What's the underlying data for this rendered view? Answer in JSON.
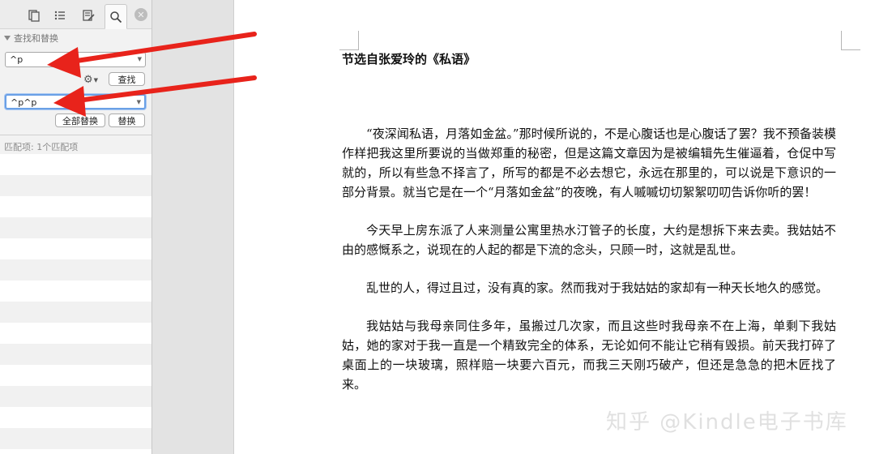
{
  "sidebar": {
    "tabs": [
      {
        "name": "pages-icon"
      },
      {
        "name": "list-icon"
      },
      {
        "name": "edit-icon"
      },
      {
        "name": "search-icon"
      }
    ],
    "section_title": "查找和替换",
    "find_value": "^p",
    "find_button": "查找",
    "replace_value": "^p^p",
    "replace_all_button": "全部替换",
    "replace_button": "替换",
    "match_count": "匹配项: 1个匹配项",
    "close_icon": "close-icon",
    "gear_icon": "gear-icon"
  },
  "document": {
    "title": "节选自张爱玲的《私语》",
    "paragraphs": [
      "“夜深闻私语，月落如金盆。”那时候所说的，不是心腹话也是心腹话了罢？我不预备装模作样把我这里所要说的当做郑重的秘密，但是这篇文章因为是被编辑先生催逼着，仓促中写就的，所以有些急不择言了，所写的都是不必去想它，永远在那里的，可以说是下意识的一部分背景。就当它是在一个“月落如金盆”的夜晚，有人嘁嘁切切絮絮叨叨告诉你听的罢！",
      "今天早上房东派了人来测量公寓里热水汀管子的长度，大约是想拆下来去卖。我姑姑不由的感慨系之，说现在的人起的都是下流的念头，只顾一时，这就是乱世。",
      "乱世的人，得过且过，没有真的家。然而我对于我姑姑的家却有一种天长地久的感觉。",
      "我姑姑与我母亲同住多年，虽搬过几次家，而且这些时我母亲不在上海，单剩下我姑姑，她的家对于我一直是一个精致完全的体系，无论如何不能让它稍有毁损。前天我打碎了桌面上的一块玻璃，照样赔一块要六百元，而我三天刚巧破产，但还是急急的把木匠找了来。"
    ]
  },
  "watermark": "知乎 @Kindle电子书库",
  "colors": {
    "arrow": "#e8231b",
    "focus": "#6aa0e6"
  }
}
